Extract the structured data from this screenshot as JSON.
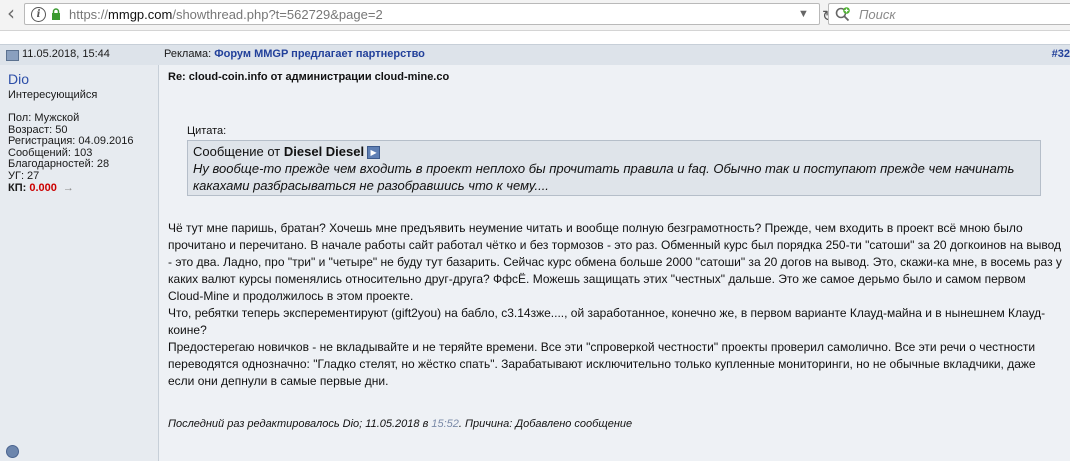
{
  "browser": {
    "url_prefix": "https://",
    "url_domain": "mmgp.com",
    "url_path": "/showthread.php?t=562729&page=2",
    "search_placeholder": "Поиск"
  },
  "post": {
    "date": "11.05.2018, 15:44",
    "ad_prefix": "Реклама: ",
    "ad_link": "Форум MMGP предлагает партнерство",
    "number": "#32",
    "title": "Re: cloud-coin.info от администрации cloud-mine.co"
  },
  "user": {
    "name": "Dio",
    "title": "Интересующийся",
    "info": [
      "Пол: Мужской",
      "Возраст: 50",
      "Регистрация: 04.09.2016",
      "Сообщений: 103",
      "Благодарностей: 28",
      "УГ: 27"
    ],
    "kp_label": "КП: ",
    "kp_value": "0.000",
    "kp_arrow": "→"
  },
  "quote": {
    "label": "Цитата:",
    "author_prefix": "Сообщение от ",
    "author": "Diesel Diesel",
    "text": "Ну вообще-то прежде чем входить в проект неплохо бы прочитать правила и faq. Обычно так и поступают прежде чем начинать какахами разбрасываться не разобравшись что к чему...."
  },
  "body": [
    "Чё тут мне паришь, братан? Хочешь мне предъявить неумение читать и вообще полную безграмотность? Прежде, чем входить в проект всё мною было прочитано и перечитано. В начале работы сайт работал чётко и без тормозов - это раз. Обменный курс был порядка 250-ти \"сатоши\" за 20 догкоинов на вывод - это два. Ладно, про \"три\" и \"четыре\" не буду тут базарить. Сейчас курс обмена больше 2000 \"сатоши\" за 20 догов на вывод. Это, скажи-ка мне, в восемь раз у каких валют курсы поменялись относительно друг-друга? ФфсЁ. Можешь защищать этих \"честных\" дальше. Это же самое дерьмо было и самом первом Cloud-Mine и продолжилось в этом проекте.",
    "Что, ребятки теперь эксперементируют (gift2you) на бабло, с3.14зже...., ой заработанное, конечно же, в первом варианте Клауд-майна и в нынешнем Клауд-коине?",
    "Предостерегаю новичков - не вкладывайте и не теряйте времени. Все эти \"спроверкой честности\" проекты проверил самолично. Все эти речи о честности переводятся однозначно: \"Гладко стелят, но жёстко спать\". Зарабатывают исключительно только купленные мониторинги, но не обычные вкладчики, даже если они депнули в самые первые дни."
  ],
  "edit": {
    "prefix": "Последний раз редактировалось Dio; 11.05.2018 в ",
    "time": "15:52",
    "suffix": ". Причина: Добавлено сообщение"
  }
}
